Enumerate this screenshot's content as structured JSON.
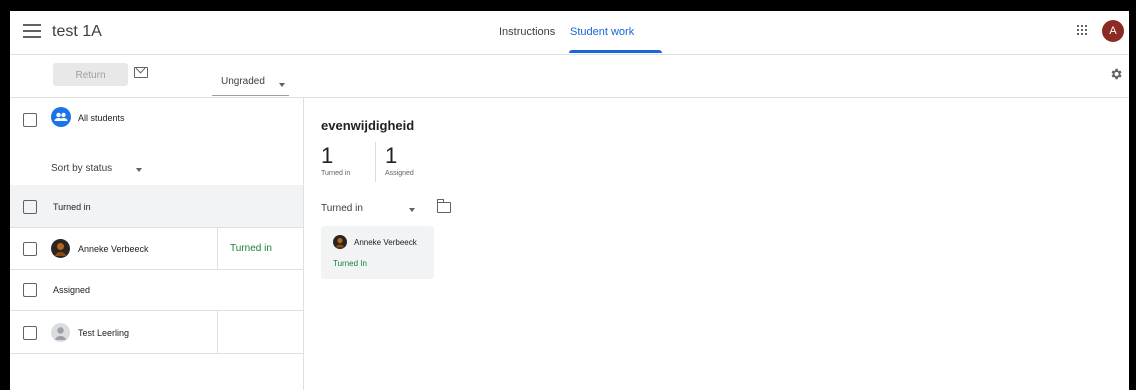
{
  "header": {
    "class_title": "test 1A",
    "tabs": [
      {
        "label": "Instructions"
      },
      {
        "label": "Student work"
      }
    ],
    "account_initial": "A"
  },
  "toolbar": {
    "return_label": "Return",
    "grade_filter": "Ungraded"
  },
  "left_panel": {
    "all_students_label": "All students",
    "sort_label": "Sort by status",
    "groups": [
      {
        "label": "Turned in",
        "students": [
          {
            "name": "Anneke Verbeeck",
            "status": "Turned in"
          }
        ]
      },
      {
        "label": "Assigned",
        "students": [
          {
            "name": "Test Leerling",
            "status": ""
          }
        ]
      }
    ]
  },
  "right_panel": {
    "assignment_title": "evenwijdigheid",
    "stats": [
      {
        "value": "1",
        "label": "Turned in"
      },
      {
        "value": "1",
        "label": "Assigned"
      }
    ],
    "filter_label": "Turned in",
    "cards": [
      {
        "name": "Anneke Verbeeck",
        "status": "Turned In"
      }
    ]
  },
  "colors": {
    "accent": "#1967d2",
    "status_green": "#188038",
    "avatar_bg": "#8b2c24"
  },
  "icons": [
    "menu-icon",
    "mail-icon",
    "gear-icon",
    "apps-icon",
    "group-icon",
    "folder-icon",
    "chevron-down-icon"
  ]
}
